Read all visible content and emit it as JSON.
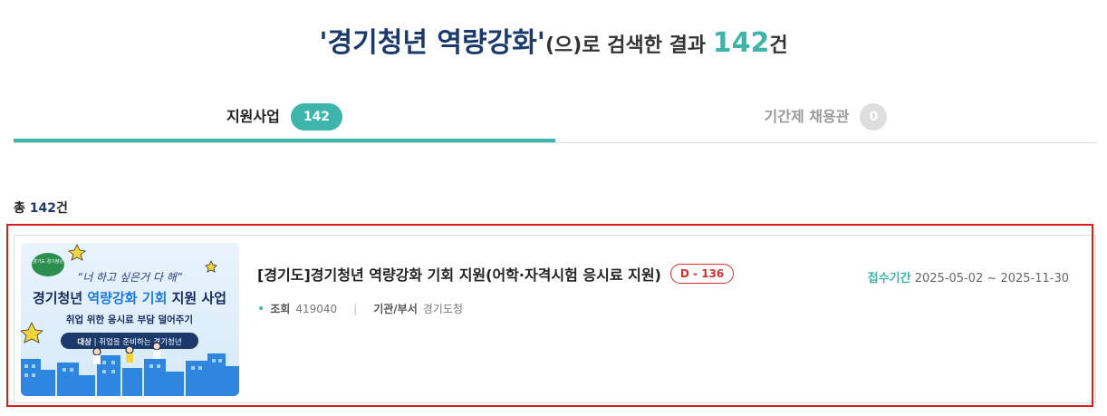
{
  "headline": {
    "query": "'경기청년 역량강화'",
    "suffix": "(으)로 검색한 결과 ",
    "count": "142",
    "unit": "건"
  },
  "tabs": [
    {
      "label": "지원사업",
      "count": "142"
    },
    {
      "label": "기간제 채용관",
      "count": "0"
    }
  ],
  "summary": {
    "prefix": "총 ",
    "count": "142",
    "unit": "건"
  },
  "results": [
    {
      "title": "[경기도]경기청년 역량강화 기회 지원(어학·자격시험 응시료 지원)",
      "dday": "D - 136",
      "period_label": "접수기간",
      "period_value": "2025-05-02 ~ 2025-11-30",
      "views_label": "조회",
      "views": "419040",
      "dept_label": "기관/부서",
      "dept": "경기도청",
      "thumbnail": {
        "logo_text": "경기도 경기청년",
        "quote": "“너 하고 싶은거 다 해”",
        "title_a": "경기청년 ",
        "title_b": "역량강화 기회",
        "title_c": " 지원 사업",
        "subtitle": "취업 위한 응시료 부담 덜어주기",
        "target_label": "대상",
        "target_value": "취업을 준비하는 경기청년"
      }
    }
  ],
  "colors": {
    "accent": "#3db5aa",
    "navy": "#1b3a6b",
    "dday": "#d32f2f",
    "highlight": "#e01c1c"
  }
}
